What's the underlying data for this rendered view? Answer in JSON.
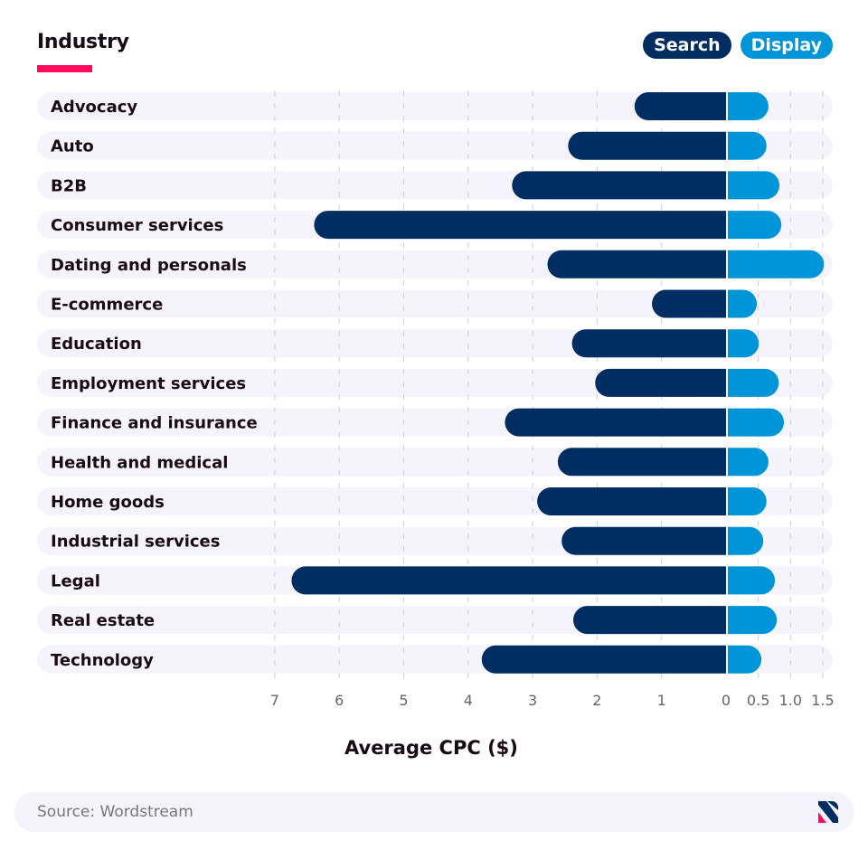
{
  "header": {
    "title": "Industry",
    "accent_color": "#ff0a5c"
  },
  "legend": {
    "items": [
      {
        "label": "Search",
        "color": "#002d62"
      },
      {
        "label": "Display",
        "color": "#0094d9"
      }
    ]
  },
  "footer": {
    "source": "Source: Wordstream",
    "logo": "brand-logo-icon"
  },
  "chart_data": {
    "type": "bar",
    "orientation": "horizontal-diverging",
    "title": "Industry",
    "xlabel": "Average CPC ($)",
    "ylabel": "",
    "categories": [
      "Advocacy",
      "Auto",
      "B2B",
      "Consumer services",
      "Dating and personals",
      "E-commerce",
      "Education",
      "Employment services",
      "Finance and insurance",
      "Health and medical",
      "Home goods",
      "Industrial services",
      "Legal",
      "Real estate",
      "Technology"
    ],
    "series": [
      {
        "name": "Search",
        "color": "#002d62",
        "direction": "left",
        "values": [
          1.42,
          2.45,
          3.32,
          6.39,
          2.77,
          1.15,
          2.39,
          2.03,
          3.43,
          2.61,
          2.93,
          2.55,
          6.74,
          2.37,
          3.79
        ]
      },
      {
        "name": "Display",
        "color": "#0094d9",
        "direction": "right",
        "values": [
          0.63,
          0.6,
          0.8,
          0.83,
          1.49,
          0.45,
          0.48,
          0.79,
          0.87,
          0.63,
          0.6,
          0.55,
          0.73,
          0.76,
          0.52
        ]
      }
    ],
    "search_axis": {
      "range": [
        0,
        7
      ],
      "ticks": [
        "7",
        "6",
        "5",
        "4",
        "3",
        "2",
        "1",
        "0"
      ]
    },
    "display_axis": {
      "range": [
        0,
        1.5
      ],
      "ticks": [
        "0.5",
        "1.0",
        "1.5"
      ]
    },
    "grid": true,
    "legend_position": "top-right"
  }
}
